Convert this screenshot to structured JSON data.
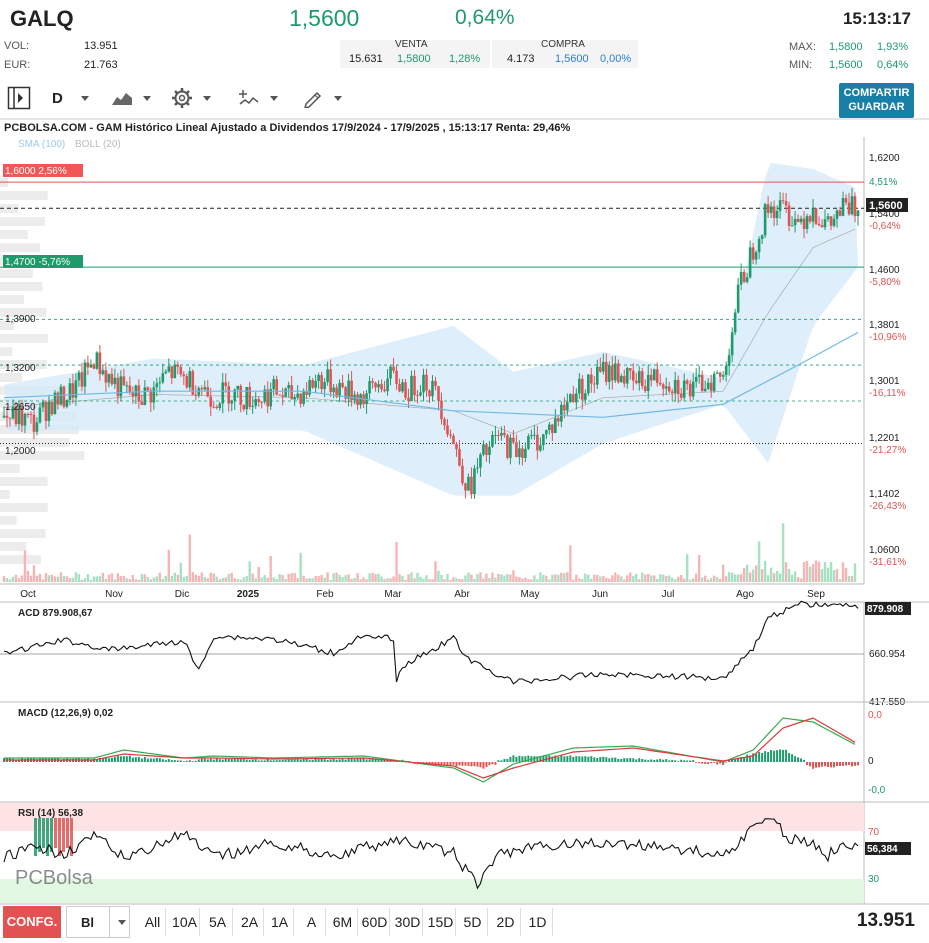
{
  "header": {
    "ticker": "GALQ",
    "price": "1,5600",
    "change_pct": "0,64%",
    "time": "15:13:17",
    "vol_label": "VOL:",
    "vol_value": "13.951",
    "eur_label": "EUR:",
    "eur_value": "21.763",
    "venta_label": "VENTA",
    "venta_qty": "15.631",
    "venta_price": "1,5800",
    "venta_pct": "1,28%",
    "compra_label": "COMPRA",
    "compra_qty": "4.173",
    "compra_price": "1,5600",
    "compra_pct": "0,00%",
    "max_label": "MAX:",
    "max_price": "1,5800",
    "max_pct": "1,93%",
    "min_label": "MIN:",
    "min_price": "1,5600",
    "min_pct": "0,64%"
  },
  "toolbar": {
    "period": "D",
    "share_label_1": "COMPARTIR",
    "share_label_2": "GUARDAR"
  },
  "chart": {
    "title": "PCBOLSA.COM - GAM Histórico Lineal Ajustado a Dividendos 17/9/2024 - 17/9/2025 , 15:13:17 Renta: 29,46%",
    "legend_sma": "SMA (100)",
    "legend_boll": "BOLL (20)",
    "watermark": "PCBolsa",
    "line_hi_label": "1,6000  2,56%",
    "line_lo_label": "1,4700  -5,76%",
    "level_labels": [
      "1,3900",
      "1,3200",
      "1,2650",
      "1,2000"
    ],
    "y_ticks": [
      {
        "v": "1,6200",
        "p": "",
        "pc": "green"
      },
      {
        "v": "",
        "p": "4,51%",
        "pc": "green"
      },
      {
        "v": "1,5400",
        "p": "-0,64%",
        "pc": "red"
      },
      {
        "v": "1,4600",
        "p": "-5,80%",
        "pc": "red"
      },
      {
        "v": "1,3801",
        "p": "-10,96%",
        "pc": "red"
      },
      {
        "v": "1,3001",
        "p": "-16,11%",
        "pc": "red"
      },
      {
        "v": "1,2201",
        "p": "-21,27%",
        "pc": "red"
      },
      {
        "v": "1,1402",
        "p": "-26,43%",
        "pc": "red"
      },
      {
        "v": "1,0600",
        "p": "-31,61%",
        "pc": "red"
      }
    ],
    "current_price_label": "1,5600",
    "x_labels": [
      "Oct",
      "Nov",
      "Dic",
      "2025",
      "Feb",
      "Mar",
      "Abr",
      "May",
      "Jun",
      "Jul",
      "Ago",
      "Sep"
    ]
  },
  "acd": {
    "label": "ACD  879.908,67",
    "value_box": "879.908",
    "mid": "660.954",
    "low": "417.550"
  },
  "macd": {
    "label": "MACD (12,26,9)  0,02",
    "t1": "0,0",
    "t2": "0",
    "t3": "-0,0"
  },
  "rsi": {
    "label": "RSI (14)  56,38",
    "value_box": "56,384",
    "t70": "70",
    "t30": "30"
  },
  "bottom": {
    "config_label": "CONFG.",
    "select_value": "Bl",
    "ranges": [
      "All",
      "10A",
      "5A",
      "2A",
      "1A",
      "A",
      "6M",
      "60D",
      "30D",
      "15D",
      "5D",
      "2D",
      "1D"
    ],
    "volume_total": "13.951"
  },
  "colors": {
    "up": "#1f9a6a",
    "down": "#e05353",
    "accent": "#1a7fa6",
    "band": "#d6ebfa"
  },
  "chart_data": {
    "type": "candlestick",
    "title": "PCBOLSA.COM - GAM Histórico Lineal Ajustado a Dividendos 17/9/2024 - 17/9/2025",
    "x_months": [
      "Oct",
      "Nov",
      "Dic",
      "2025",
      "Feb",
      "Mar",
      "Abr",
      "May",
      "Jun",
      "Jul",
      "Ago",
      "Sep"
    ],
    "close_path": [
      [
        0,
        1.24
      ],
      [
        5,
        1.24
      ],
      [
        10,
        1.23
      ],
      [
        15,
        1.26
      ],
      [
        20,
        1.27
      ],
      [
        25,
        1.29
      ],
      [
        30,
        1.33
      ],
      [
        35,
        1.3
      ],
      [
        40,
        1.28
      ],
      [
        45,
        1.27
      ],
      [
        50,
        1.28
      ],
      [
        55,
        1.31
      ],
      [
        60,
        1.3
      ],
      [
        65,
        1.29
      ],
      [
        70,
        1.27
      ],
      [
        75,
        1.28
      ],
      [
        80,
        1.27
      ],
      [
        85,
        1.27
      ],
      [
        90,
        1.28
      ],
      [
        95,
        1.27
      ],
      [
        100,
        1.28
      ],
      [
        105,
        1.3
      ],
      [
        110,
        1.29
      ],
      [
        115,
        1.28
      ],
      [
        120,
        1.27
      ],
      [
        125,
        1.29
      ],
      [
        130,
        1.3
      ],
      [
        135,
        1.28
      ],
      [
        140,
        1.3
      ],
      [
        145,
        1.27
      ],
      [
        150,
        1.2
      ],
      [
        155,
        1.13
      ],
      [
        160,
        1.18
      ],
      [
        165,
        1.21
      ],
      [
        170,
        1.19
      ],
      [
        175,
        1.2
      ],
      [
        180,
        1.21
      ],
      [
        185,
        1.24
      ],
      [
        190,
        1.28
      ],
      [
        195,
        1.29
      ],
      [
        200,
        1.31
      ],
      [
        205,
        1.31
      ],
      [
        210,
        1.29
      ],
      [
        215,
        1.3
      ],
      [
        220,
        1.3
      ],
      [
        225,
        1.29
      ],
      [
        230,
        1.28
      ],
      [
        235,
        1.3
      ],
      [
        240,
        1.3
      ],
      [
        245,
        1.43
      ],
      [
        250,
        1.5
      ],
      [
        255,
        1.56
      ],
      [
        260,
        1.56
      ],
      [
        265,
        1.54
      ],
      [
        270,
        1.56
      ],
      [
        275,
        1.53
      ],
      [
        280,
        1.56
      ],
      [
        285,
        1.56
      ]
    ],
    "sma100_path": [
      [
        0,
        1.27
      ],
      [
        50,
        1.28
      ],
      [
        100,
        1.28
      ],
      [
        150,
        1.25
      ],
      [
        200,
        1.24
      ],
      [
        240,
        1.26
      ],
      [
        265,
        1.32
      ],
      [
        285,
        1.37
      ]
    ],
    "boll_upper": [
      [
        0,
        1.29
      ],
      [
        50,
        1.33
      ],
      [
        100,
        1.32
      ],
      [
        150,
        1.38
      ],
      [
        170,
        1.31
      ],
      [
        200,
        1.34
      ],
      [
        240,
        1.3
      ],
      [
        255,
        1.63
      ],
      [
        270,
        1.62
      ],
      [
        285,
        1.59
      ]
    ],
    "boll_lower": [
      [
        0,
        1.22
      ],
      [
        50,
        1.22
      ],
      [
        100,
        1.22
      ],
      [
        150,
        1.12
      ],
      [
        170,
        1.12
      ],
      [
        200,
        1.2
      ],
      [
        240,
        1.26
      ],
      [
        255,
        1.17
      ],
      [
        270,
        1.38
      ],
      [
        285,
        1.47
      ]
    ],
    "hlines": {
      "resistance": 1.6,
      "support": 1.47,
      "current": 1.56,
      "levels": [
        1.39,
        1.32,
        1.265,
        1.2
      ]
    },
    "ylim": [
      1.04,
      1.64
    ],
    "acd": {
      "last": 879908.67,
      "mid_line": 660954,
      "low": 417550
    },
    "macd_last": 0.02,
    "rsi_last": 56.38,
    "rsi_bands": [
      30,
      70
    ]
  }
}
